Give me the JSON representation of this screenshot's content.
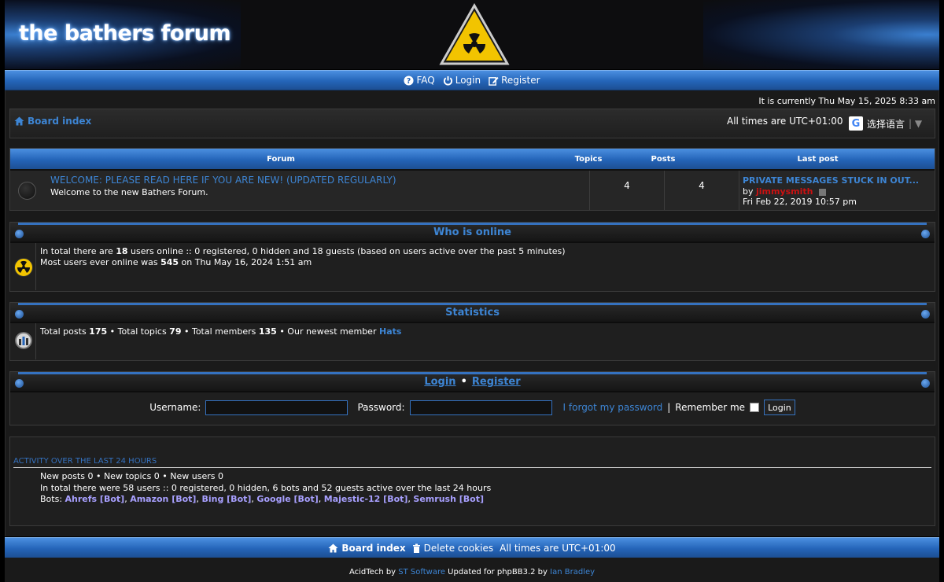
{
  "header": {
    "site_title": "the bathers forum",
    "nav": {
      "faq": "FAQ",
      "login": "Login",
      "register": "Register"
    }
  },
  "status": {
    "current_time": "It is currently Thu May 15, 2025 8:33 am"
  },
  "breadcrumbs": {
    "board_index": "Board index",
    "timezone": "All times are UTC+01:00",
    "translate_label": "选择语言"
  },
  "forum_table": {
    "headers": {
      "forum": "Forum",
      "topics": "Topics",
      "posts": "Posts",
      "last_post": "Last post"
    },
    "rows": [
      {
        "name": "WELCOME: PLEASE READ HERE IF YOU ARE NEW! (UPDATED REGULARLY)",
        "description": "Welcome to the new Bathers Forum.",
        "topics": "4",
        "posts": "4",
        "last_post_title": "PRIVATE MESSAGES STUCK IN OUT...",
        "last_post_by_prefix": "by",
        "last_post_user": "jimmysmith",
        "last_post_date": "Fri Feb 22, 2019 10:57 pm"
      }
    ]
  },
  "who_online": {
    "title": "Who is online",
    "line1_a": "In total there are ",
    "line1_count": "18",
    "line1_b": " users online :: 0 registered, 0 hidden and 18 guests (based on users active over the past 5 minutes)",
    "line2_a": "Most users ever online was ",
    "line2_count": "545",
    "line2_b": " on Thu May 16, 2024 1:51 am"
  },
  "statistics": {
    "title": "Statistics",
    "posts_label": "Total posts ",
    "posts": "175",
    "topics_label": " • Total topics ",
    "topics": "79",
    "members_label": " • Total members ",
    "members": "135",
    "newest_label": " • Our newest member ",
    "newest_member": "Hats"
  },
  "login_panel": {
    "login_link": "Login",
    "bullet": "•",
    "register_link": "Register",
    "username_label": "Username:",
    "password_label": "Password:",
    "forgot": "I forgot my password",
    "pipe": "|",
    "remember": "Remember me",
    "button": "Login"
  },
  "activity": {
    "title": "ACTIVITY OVER THE LAST 24 HOURS",
    "line1": "New posts 0 • New topics 0 • New users 0",
    "line2": "In total there were 58 users :: 0 registered, 0 hidden, 6 bots and 52 guests active over the last 24 hours",
    "bots_label": "Bots: ",
    "bots": [
      "Ahrefs [Bot]",
      "Amazon [Bot]",
      "Bing [Bot]",
      "Google [Bot]",
      "Majestic-12 [Bot]",
      "Semrush [Bot]"
    ]
  },
  "footer": {
    "board_index": "Board index",
    "delete_cookies": "Delete cookies",
    "timezone": "All times are UTC+01:00",
    "credit_a": "AcidTech by ",
    "credit_st": "ST Software",
    "credit_b": " Updated for phpBB3.2 by ",
    "credit_ian": "Ian Bradley"
  },
  "colors": {
    "accent_blue": "#3d85d4",
    "bar_blue": "#2464b8",
    "user_red": "#cc1111",
    "bot_purple": "#a8a0ff"
  }
}
